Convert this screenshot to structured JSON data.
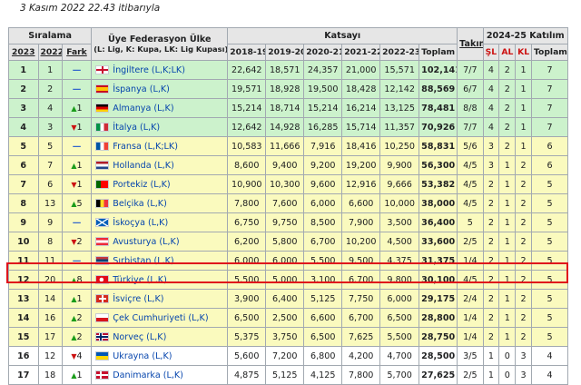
{
  "caption": "3 Kasım 2022 22.43 itibarıyla",
  "headers": {
    "siralama": "Sıralama",
    "y2023": "2023",
    "y2022": "2022",
    "fark": "Fark",
    "federasyon": "Üye Federasyon Ülke",
    "federasyon_sub": "(L: Lig, K: Kupa, LK: Lig Kupası)",
    "katsayi": "Katsayı",
    "k1819": "2018-19",
    "k1920": "2019-20",
    "k2021": "2020-21",
    "k2122": "2021-22",
    "k2223": "2022-23",
    "toplam": "Toplam",
    "takim": "Takım",
    "katilim": "2024-25 Katılım",
    "sl": "ŞL",
    "al": "AL",
    "kl": "KL",
    "katilim_toplam": "Toplam"
  },
  "rows": [
    {
      "r23": "1",
      "r22": "1",
      "change": "same",
      "delta": "—",
      "country": "İngiltere (L,K;LK)",
      "k": [
        "22,642",
        "18,571",
        "24,357",
        "21,000",
        "15,571"
      ],
      "total": "102,141",
      "takim": "7/7",
      "sl": "4",
      "al": "2",
      "kl": "1",
      "tot": "7",
      "bg": "#ccf2cc",
      "flag": "eng"
    },
    {
      "r23": "2",
      "r22": "2",
      "change": "same",
      "delta": "—",
      "country": "İspanya (L,K)",
      "k": [
        "19,571",
        "18,928",
        "19,500",
        "18,428",
        "12,142"
      ],
      "total": "88,569",
      "takim": "6/7",
      "sl": "4",
      "al": "2",
      "kl": "1",
      "tot": "7",
      "bg": "#ccf2cc",
      "flag": "esp"
    },
    {
      "r23": "3",
      "r22": "4",
      "change": "up",
      "delta": "1",
      "country": "Almanya (L,K)",
      "k": [
        "15,214",
        "18,714",
        "15,214",
        "16,214",
        "13,125"
      ],
      "total": "78,481",
      "takim": "8/8",
      "sl": "4",
      "al": "2",
      "kl": "1",
      "tot": "7",
      "bg": "#ccf2cc",
      "flag": "ger"
    },
    {
      "r23": "4",
      "r22": "3",
      "change": "down",
      "delta": "1",
      "country": "İtalya (L,K)",
      "k": [
        "12,642",
        "14,928",
        "16,285",
        "15,714",
        "11,357"
      ],
      "total": "70,926",
      "takim": "7/7",
      "sl": "4",
      "al": "2",
      "kl": "1",
      "tot": "7",
      "bg": "#ccf2cc",
      "flag": "ita"
    },
    {
      "r23": "5",
      "r22": "5",
      "change": "same",
      "delta": "—",
      "country": "Fransa (L,K;LK)",
      "k": [
        "10,583",
        "11,666",
        "7,916",
        "18,416",
        "10,250"
      ],
      "total": "58,831",
      "takim": "5/6",
      "sl": "3",
      "al": "2",
      "kl": "1",
      "tot": "6",
      "bg": "#fafabe",
      "flag": "fra"
    },
    {
      "r23": "6",
      "r22": "7",
      "change": "up",
      "delta": "1",
      "country": "Hollanda (L,K)",
      "k": [
        "8,600",
        "9,400",
        "9,200",
        "19,200",
        "9,900"
      ],
      "total": "56,300",
      "takim": "4/5",
      "sl": "3",
      "al": "1",
      "kl": "2",
      "tot": "6",
      "bg": "#fafabe",
      "flag": "ned"
    },
    {
      "r23": "7",
      "r22": "6",
      "change": "down",
      "delta": "1",
      "country": "Portekiz (L,K)",
      "k": [
        "10,900",
        "10,300",
        "9,600",
        "12,916",
        "9,666"
      ],
      "total": "53,382",
      "takim": "4/5",
      "sl": "2",
      "al": "1",
      "kl": "2",
      "tot": "5",
      "bg": "#fafabe",
      "flag": "por"
    },
    {
      "r23": "8",
      "r22": "13",
      "change": "up",
      "delta": "5",
      "country": "Belçika (L,K)",
      "k": [
        "7,800",
        "7,600",
        "6,000",
        "6,600",
        "10,000"
      ],
      "total": "38,000",
      "takim": "4/5",
      "sl": "2",
      "al": "1",
      "kl": "2",
      "tot": "5",
      "bg": "#fafabe",
      "flag": "bel"
    },
    {
      "r23": "9",
      "r22": "9",
      "change": "same",
      "delta": "—",
      "country": "İskoçya (L,K)",
      "k": [
        "6,750",
        "9,750",
        "8,500",
        "7,900",
        "3,500"
      ],
      "total": "36,400",
      "takim": "5",
      "sl": "2",
      "al": "1",
      "kl": "2",
      "tot": "5",
      "bg": "#fafabe",
      "flag": "sco"
    },
    {
      "r23": "10",
      "r22": "8",
      "change": "down",
      "delta": "2",
      "country": "Avusturya (L,K)",
      "k": [
        "6,200",
        "5,800",
        "6,700",
        "10,200",
        "4,500"
      ],
      "total": "33,600",
      "takim": "2/5",
      "sl": "2",
      "al": "1",
      "kl": "2",
      "tot": "5",
      "bg": "#fafabe",
      "flag": "aut"
    },
    {
      "r23": "11",
      "r22": "11",
      "change": "same",
      "delta": "—",
      "country": "Sırbistan (L,K)",
      "k": [
        "6,000",
        "6,000",
        "5,500",
        "9,500",
        "4,375"
      ],
      "total": "31,375",
      "takim": "1/4",
      "sl": "2",
      "al": "1",
      "kl": "2",
      "tot": "5",
      "bg": "#fafabe",
      "flag": "srb"
    },
    {
      "r23": "12",
      "r22": "20",
      "change": "up",
      "delta": "8",
      "country": "Türkiye (L,K)",
      "k": [
        "5,500",
        "5,000",
        "3,100",
        "6,700",
        "9,800"
      ],
      "total": "30,100",
      "takim": "4/5",
      "sl": "2",
      "al": "1",
      "kl": "2",
      "tot": "5",
      "bg": "#fafabe",
      "flag": "tur"
    },
    {
      "r23": "13",
      "r22": "14",
      "change": "up",
      "delta": "1",
      "country": "İsviçre (L,K)",
      "k": [
        "3,900",
        "6,400",
        "5,125",
        "7,750",
        "6,000"
      ],
      "total": "29,175",
      "takim": "2/4",
      "sl": "2",
      "al": "1",
      "kl": "2",
      "tot": "5",
      "bg": "#fafabe",
      "flag": "sui"
    },
    {
      "r23": "14",
      "r22": "16",
      "change": "up",
      "delta": "2",
      "country": "Çek Cumhuriyeti (L,K)",
      "k": [
        "6,500",
        "2,500",
        "6,600",
        "6,700",
        "6,500"
      ],
      "total": "28,800",
      "takim": "1/4",
      "sl": "2",
      "al": "1",
      "kl": "2",
      "tot": "5",
      "bg": "#fafabe",
      "flag": "cze"
    },
    {
      "r23": "15",
      "r22": "17",
      "change": "up",
      "delta": "2",
      "country": "Norveç (L,K)",
      "k": [
        "5,375",
        "3,750",
        "6,500",
        "7,625",
        "5,500"
      ],
      "total": "28,750",
      "takim": "1/4",
      "sl": "2",
      "al": "1",
      "kl": "2",
      "tot": "5",
      "bg": "#fafabe",
      "flag": "nor"
    },
    {
      "r23": "16",
      "r22": "12",
      "change": "down",
      "delta": "4",
      "country": "Ukrayna (L,K)",
      "k": [
        "5,600",
        "7,200",
        "6,800",
        "4,200",
        "4,700"
      ],
      "total": "28,500",
      "takim": "3/5",
      "sl": "1",
      "al": "0",
      "kl": "3",
      "tot": "4",
      "bg": "#ffffff",
      "flag": "ukr"
    },
    {
      "r23": "17",
      "r22": "18",
      "change": "up",
      "delta": "1",
      "country": "Danimarka (L,K)",
      "k": [
        "4,875",
        "5,125",
        "4,125",
        "7,800",
        "5,700"
      ],
      "total": "27,625",
      "takim": "2/5",
      "sl": "1",
      "al": "0",
      "kl": "3",
      "tot": "4",
      "bg": "#ffffff",
      "flag": "den"
    }
  ],
  "colors": {
    "highlight": "#e0131b",
    "up": "#1a9c1a",
    "down": "#cc1111",
    "same": "#3366cc"
  }
}
